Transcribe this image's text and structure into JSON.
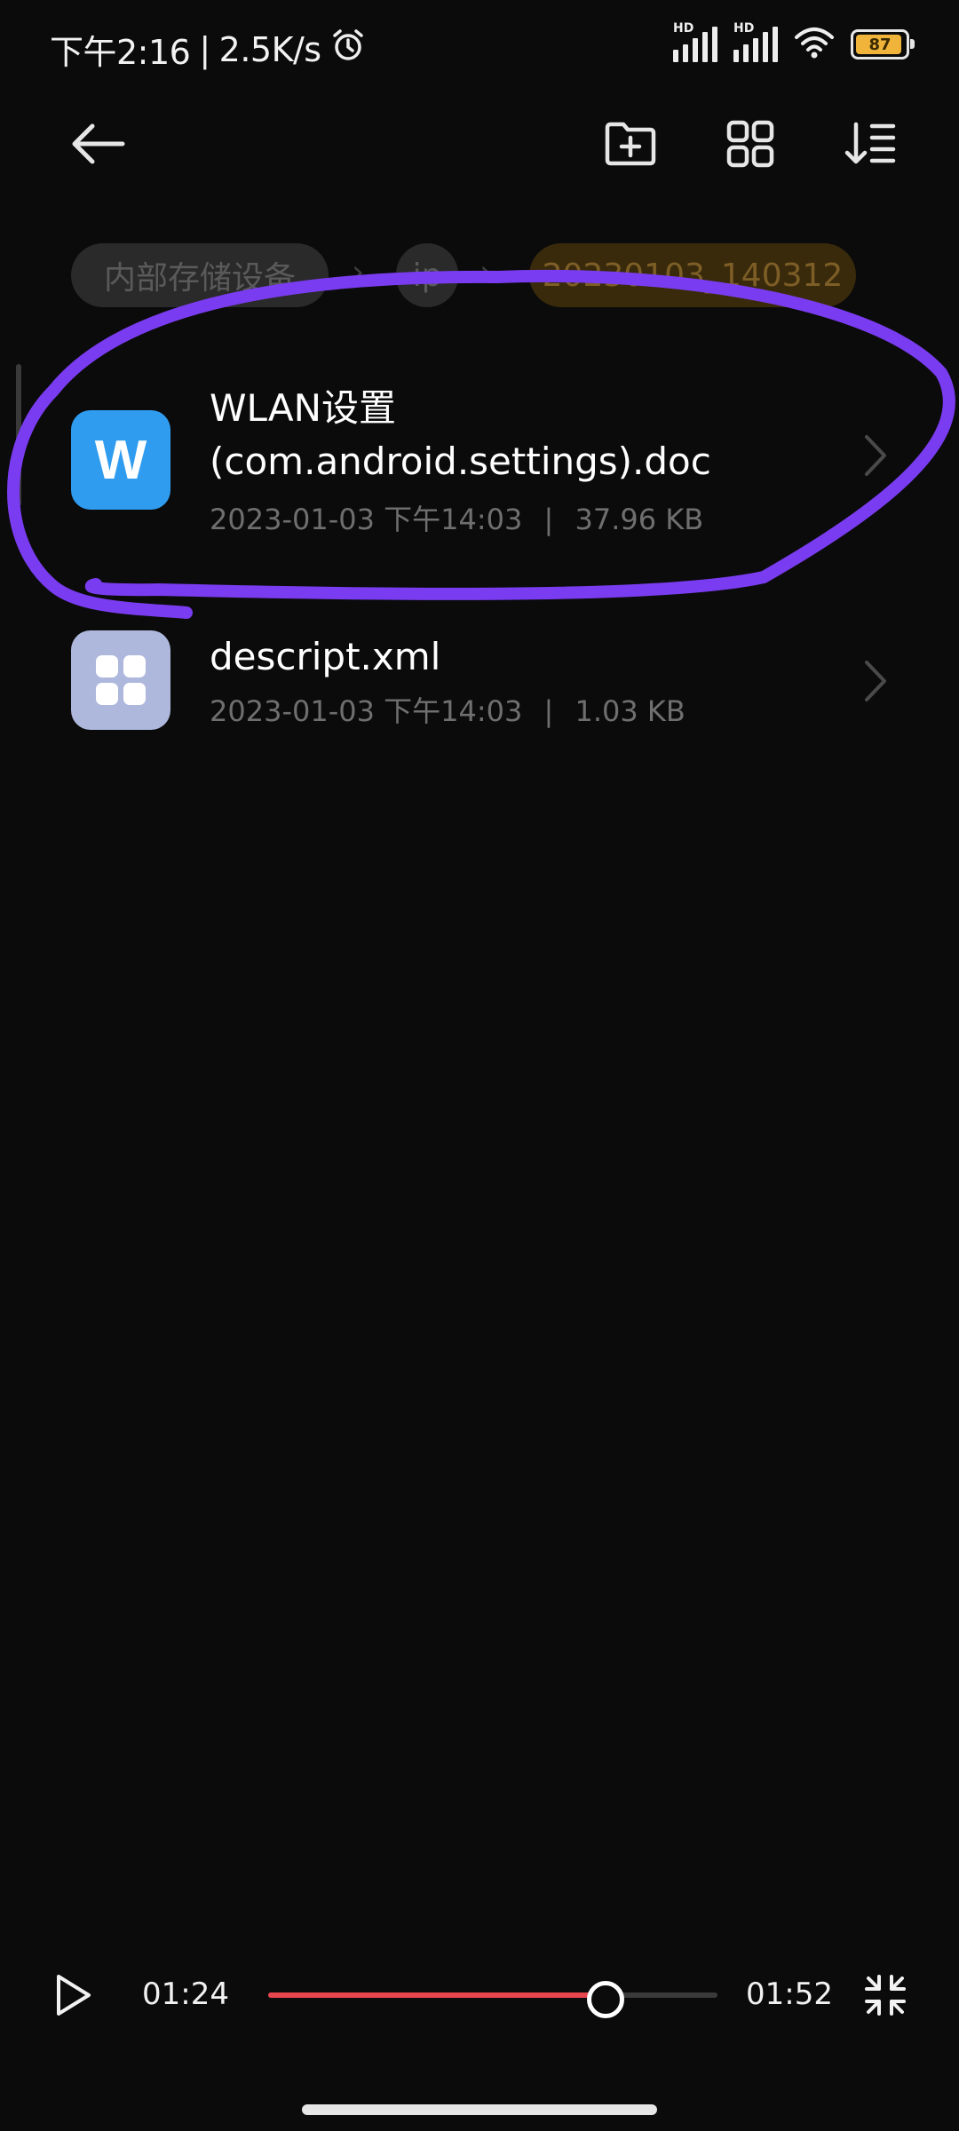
{
  "status_bar": {
    "time": "下午2:16",
    "separator": "|",
    "net_speed": "2.5K/s",
    "hd_label": "HD",
    "battery": "87",
    "icons": [
      "alarm-icon",
      "signal-icon",
      "signal-icon",
      "wifi-icon",
      "battery-icon"
    ]
  },
  "toolbar": {
    "icons": [
      "back-arrow-icon",
      "new-folder-icon",
      "grid-view-icon",
      "sort-icon"
    ]
  },
  "breadcrumb": {
    "items": [
      {
        "label": "内部存储设备"
      },
      {
        "label": "ip"
      },
      {
        "label": "20230103_140312"
      }
    ],
    "separator": "›"
  },
  "files": [
    {
      "icon_letter": "W",
      "icon": "word-doc-icon",
      "name_line1": "WLAN设置",
      "name_line2": "(com.android.settings).doc",
      "date": "2023-01-03 下午14:03",
      "divider": "|",
      "size": "37.96 KB"
    },
    {
      "icon": "app-grid-icon",
      "name_line1": "descript.xml",
      "date": "2023-01-03 下午14:03",
      "divider": "|",
      "size": "1.03 KB"
    }
  ],
  "player": {
    "elapsed": "01:24",
    "duration": "01:52",
    "progress_fraction": 0.75,
    "icons": [
      "play-icon",
      "collapse-icon"
    ]
  },
  "colors": {
    "background": "#0b0b0b",
    "accent_progress": "#e8464f",
    "annotation_stroke": "#7a3cf0",
    "breadcrumb_active": "#7d5e26",
    "word_icon_blue": "#2f9cf0",
    "xml_icon": "#aeb8dd"
  }
}
